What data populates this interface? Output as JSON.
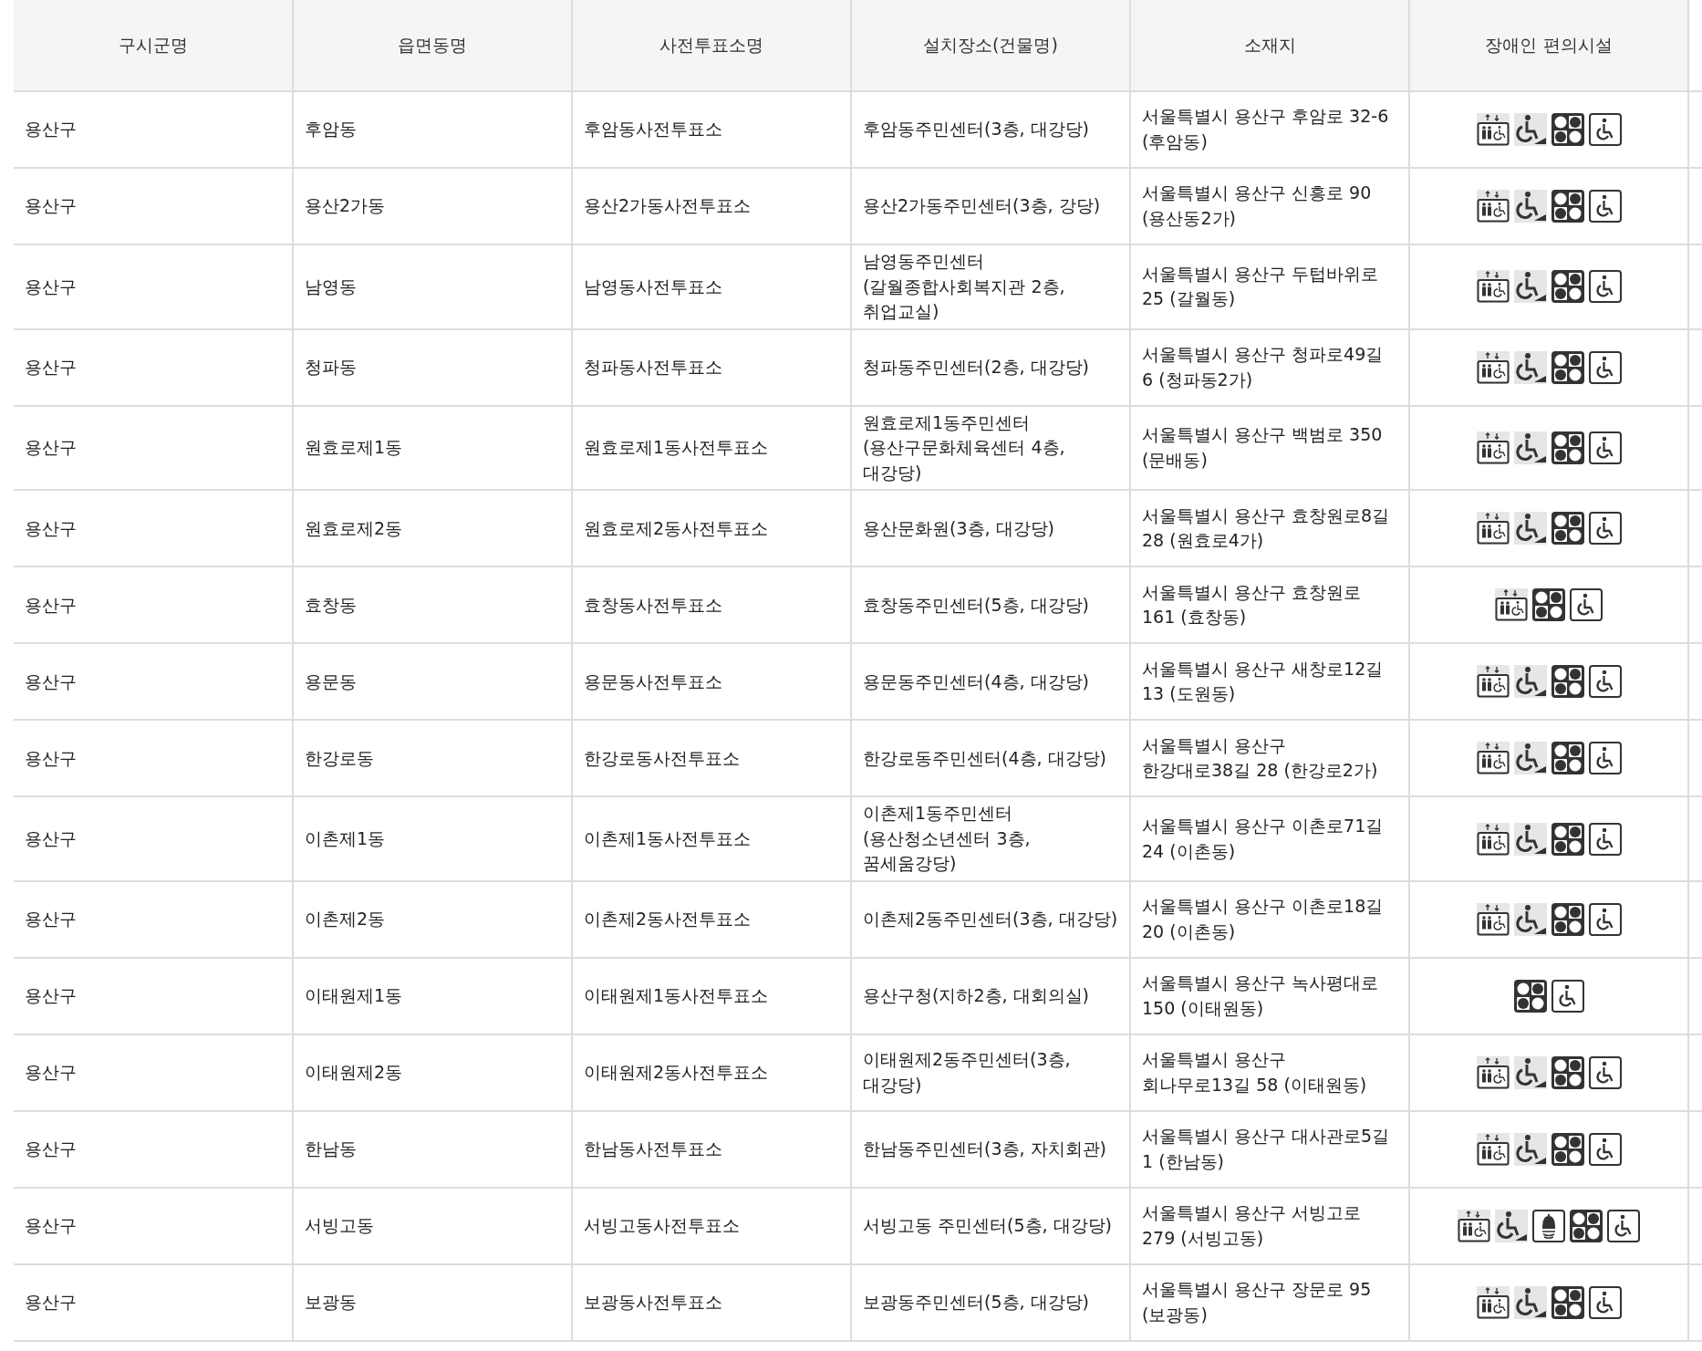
{
  "table": {
    "columns": [
      "구시군명",
      "읍면동명",
      "사전투표소명",
      "설치장소(건물명)",
      "소재지",
      "장애인 편의시설"
    ],
    "rows": [
      {
        "cells": [
          "용산구",
          "후암동",
          "후암동사전투표소",
          "후암동주민센터(3층, 대강당)",
          "서울특별시 용산구 후암로 32-6 (후암동)"
        ],
        "facilities": [
          {
            "kind": "elevator"
          },
          {
            "kind": "ramp"
          },
          {
            "kind": "dots"
          },
          {
            "kind": "wheelchair"
          }
        ]
      },
      {
        "cells": [
          "용산구",
          "용산2가동",
          "용산2가동사전투표소",
          "용산2가동주민센터(3층, 강당)",
          "서울특별시 용산구 신흥로 90 (용산동2가)"
        ],
        "facilities": [
          {
            "kind": "elevator"
          },
          {
            "kind": "ramp"
          },
          {
            "kind": "dots"
          },
          {
            "kind": "wheelchair"
          }
        ]
      },
      {
        "cells": [
          "용산구",
          "남영동",
          "남영동사전투표소",
          "남영동주민센터(갈월종합사회복지관 2층, 취업교실)",
          "서울특별시 용산구 두텁바위로 25 (갈월동)"
        ],
        "facilities": [
          {
            "kind": "elevator"
          },
          {
            "kind": "ramp"
          },
          {
            "kind": "dots"
          },
          {
            "kind": "wheelchair"
          }
        ]
      },
      {
        "cells": [
          "용산구",
          "청파동",
          "청파동사전투표소",
          "청파동주민센터(2층, 대강당)",
          "서울특별시 용산구 청파로49길 6 (청파동2가)"
        ],
        "facilities": [
          {
            "kind": "elevator"
          },
          {
            "kind": "ramp"
          },
          {
            "kind": "dots"
          },
          {
            "kind": "wheelchair"
          }
        ]
      },
      {
        "cells": [
          "용산구",
          "원효로제1동",
          "원효로제1동사전투표소",
          "원효로제1동주민센터(용산구문화체육센터 4층,대강당)",
          "서울특별시 용산구 백범로 350 (문배동)"
        ],
        "facilities": [
          {
            "kind": "elevator"
          },
          {
            "kind": "ramp"
          },
          {
            "kind": "dots"
          },
          {
            "kind": "wheelchair"
          }
        ]
      },
      {
        "cells": [
          "용산구",
          "원효로제2동",
          "원효로제2동사전투표소",
          "용산문화원(3층, 대강당)",
          "서울특별시 용산구 효창원로8길 28 (원효로4가)"
        ],
        "facilities": [
          {
            "kind": "elevator"
          },
          {
            "kind": "ramp"
          },
          {
            "kind": "dots"
          },
          {
            "kind": "wheelchair"
          }
        ]
      },
      {
        "cells": [
          "용산구",
          "효창동",
          "효창동사전투표소",
          "효창동주민센터(5층, 대강당)",
          "서울특별시 용산구 효창원로 161 (효창동)"
        ],
        "facilities": [
          {
            "kind": "elevator"
          },
          {
            "kind": "dots"
          },
          {
            "kind": "wheelchair"
          }
        ]
      },
      {
        "cells": [
          "용산구",
          "용문동",
          "용문동사전투표소",
          "용문동주민센터(4층, 대강당)",
          "서울특별시 용산구 새창로12길 13 (도원동)"
        ],
        "facilities": [
          {
            "kind": "elevator"
          },
          {
            "kind": "ramp"
          },
          {
            "kind": "dots"
          },
          {
            "kind": "wheelchair"
          }
        ]
      },
      {
        "cells": [
          "용산구",
          "한강로동",
          "한강로동사전투표소",
          "한강로동주민센터(4층, 대강당)",
          "서울특별시 용산구 한강대로38길 28 (한강로2가)"
        ],
        "facilities": [
          {
            "kind": "elevator"
          },
          {
            "kind": "ramp"
          },
          {
            "kind": "dots"
          },
          {
            "kind": "wheelchair"
          }
        ]
      },
      {
        "cells": [
          "용산구",
          "이촌제1동",
          "이촌제1동사전투표소",
          "이촌제1동주민센터(용산청소년센터 3층, 꿈세움강당)",
          "서울특별시 용산구 이촌로71길 24 (이촌동)"
        ],
        "facilities": [
          {
            "kind": "elevator"
          },
          {
            "kind": "ramp"
          },
          {
            "kind": "dots"
          },
          {
            "kind": "wheelchair"
          }
        ]
      },
      {
        "cells": [
          "용산구",
          "이촌제2동",
          "이촌제2동사전투표소",
          "이촌제2동주민센터(3층, 대강당)",
          "서울특별시 용산구 이촌로18길 20 (이촌동)"
        ],
        "facilities": [
          {
            "kind": "elevator"
          },
          {
            "kind": "ramp"
          },
          {
            "kind": "dots"
          },
          {
            "kind": "wheelchair"
          }
        ]
      },
      {
        "cells": [
          "용산구",
          "이태원제1동",
          "이태원제1동사전투표소",
          "용산구청(지하2층, 대회의실)",
          "서울특별시 용산구 녹사평대로 150 (이태원동)"
        ],
        "facilities": [
          {
            "kind": "dots"
          },
          {
            "kind": "wheelchair"
          }
        ]
      },
      {
        "cells": [
          "용산구",
          "이태원제2동",
          "이태원제2동사전투표소",
          "이태원제2동주민센터(3층, 대강당)",
          "서울특별시 용산구 회나무로13길 58 (이태원동)"
        ],
        "facilities": [
          {
            "kind": "elevator"
          },
          {
            "kind": "ramp"
          },
          {
            "kind": "dots"
          },
          {
            "kind": "wheelchair"
          }
        ]
      },
      {
        "cells": [
          "용산구",
          "한남동",
          "한남동사전투표소",
          "한남동주민센터(3층, 자치회관)",
          "서울특별시 용산구 대사관로5길 1 (한남동)"
        ],
        "facilities": [
          {
            "kind": "elevator"
          },
          {
            "kind": "ramp"
          },
          {
            "kind": "dots"
          },
          {
            "kind": "wheelchair"
          }
        ]
      },
      {
        "cells": [
          "용산구",
          "서빙고동",
          "서빙고동사전투표소",
          "서빙고동 주민센터(5층, 대강당)",
          "서울특별시 용산구 서빙고로 279 (서빙고동)"
        ],
        "facilities": [
          {
            "kind": "elevator"
          },
          {
            "kind": "ramp"
          },
          {
            "kind": "bell"
          },
          {
            "kind": "dots"
          },
          {
            "kind": "wheelchair"
          }
        ]
      },
      {
        "cells": [
          "용산구",
          "보광동",
          "보광동사전투표소",
          "보광동주민센터(5층, 대강당)",
          "서울특별시 용산구 장문로 95 (보광동)"
        ],
        "facilities": [
          {
            "kind": "elevator"
          },
          {
            "kind": "ramp"
          },
          {
            "kind": "dots"
          },
          {
            "kind": "wheelchair"
          }
        ]
      }
    ]
  }
}
